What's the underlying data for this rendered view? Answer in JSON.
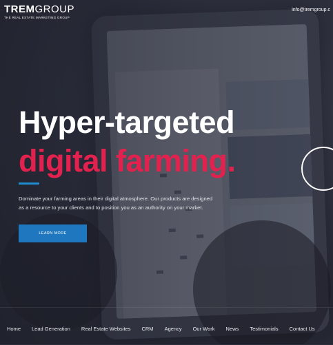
{
  "header": {
    "logo_main": "TREM",
    "logo_light": "GROUP",
    "logo_sub": "THE REAL ESTATE MARKETING GROUP",
    "email": "info@tremgroup.c"
  },
  "hero": {
    "headline_line1": "Hyper-targeted",
    "headline_line2": "digital farming.",
    "description": "Dominate your farming areas in their digital atmosphere. Our products are designed as a resource to your clients and to position you as an authority on your market.",
    "cta_label": "LEARN MORE"
  },
  "nav": {
    "items": [
      {
        "label": "Home"
      },
      {
        "label": "Lead Generation"
      },
      {
        "label": "Real Estate Websites"
      },
      {
        "label": "CRM"
      },
      {
        "label": "Agency"
      },
      {
        "label": "Our Work"
      },
      {
        "label": "News"
      },
      {
        "label": "Testimonials"
      },
      {
        "label": "Contact Us"
      }
    ]
  },
  "colors": {
    "accent_red": "#e3214e",
    "accent_blue": "#1f78bf",
    "text_white": "#ffffff"
  }
}
